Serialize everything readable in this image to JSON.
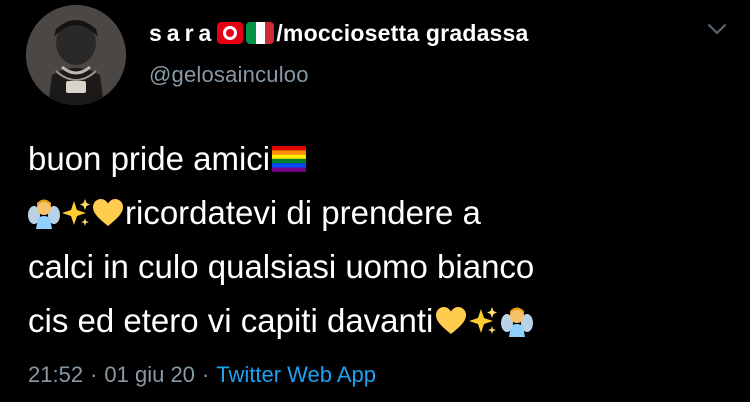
{
  "tweet": {
    "author": {
      "name_start": "sara",
      "flags": [
        "tunisia-flag",
        "italy-flag"
      ],
      "name_rest": "/mocciosetta gradassa",
      "handle": "@gelosainculoo"
    },
    "text": {
      "line1": "buon pride amici",
      "line2": "ricordatevi di prendere a",
      "line3": "calci in culo qualsiasi uomo bianco",
      "line4": "cis ed etero vi capiti davanti",
      "emojis": [
        "rainbow-flag-emoji",
        "fairy-emoji",
        "sparkles-emoji",
        "yellow-heart-emoji"
      ]
    },
    "meta": {
      "time": "21:52",
      "dot1": "·",
      "date": "01 giu 20",
      "dot2": "·",
      "source": "Twitter Web App"
    }
  },
  "colors": {
    "background": "#000000",
    "text": "#ffffff",
    "secondary": "#8899a6",
    "link": "#1da1f2"
  }
}
